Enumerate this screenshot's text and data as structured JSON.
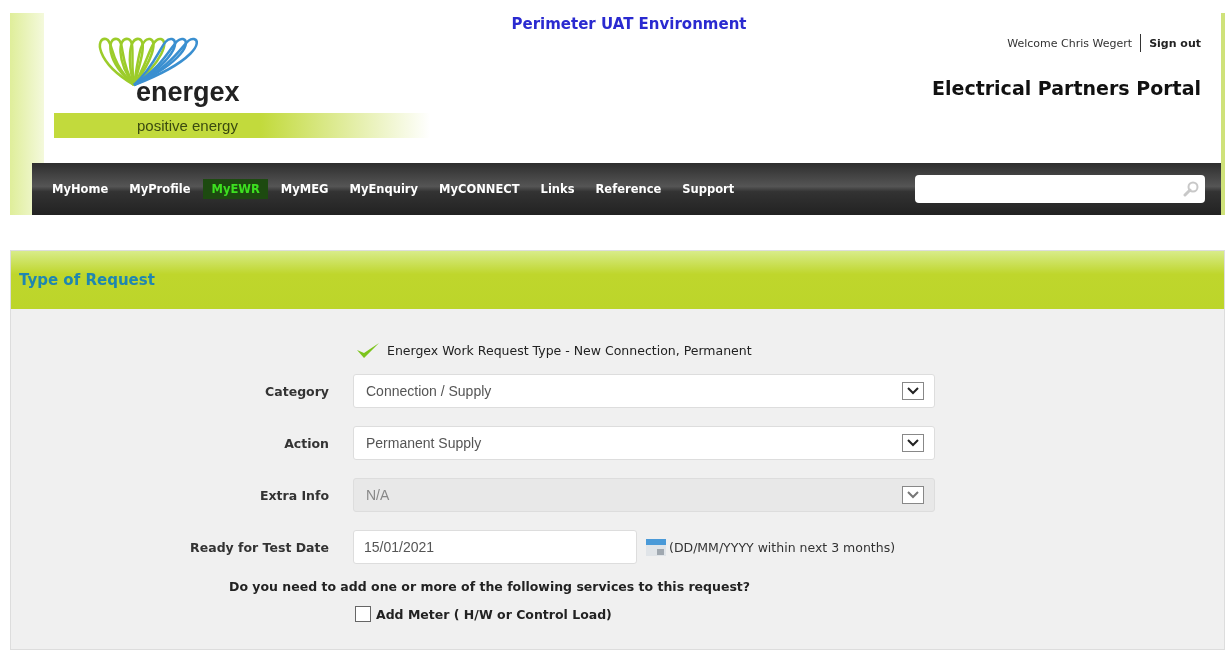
{
  "header": {
    "environment": "Perimeter UAT Environment",
    "logo": {
      "wordmark": "energex",
      "tagline": "positive energy"
    },
    "welcome": "Welcome Chris Wegert",
    "sign_out": "Sign out",
    "portal_title": "Electrical Partners Portal"
  },
  "nav": {
    "items": [
      {
        "label": "MyHome",
        "selected": false
      },
      {
        "label": "MyProfile",
        "selected": false
      },
      {
        "label": "MyEWR",
        "selected": true
      },
      {
        "label": "MyMEG",
        "selected": false
      },
      {
        "label": "MyEnquiry",
        "selected": false
      },
      {
        "label": "MyCONNECT",
        "selected": false
      },
      {
        "label": "Links",
        "selected": false
      },
      {
        "label": "Reference",
        "selected": false
      },
      {
        "label": "Support",
        "selected": false
      }
    ]
  },
  "section": {
    "title": "Type of Request",
    "request_type": "Energex Work Request Type - New Connection, Permanent",
    "fields": [
      {
        "kind": "select",
        "label": "Category",
        "value": "Connection / Supply",
        "disabled": false
      },
      {
        "kind": "select",
        "label": "Action",
        "value": "Permanent Supply",
        "disabled": false
      },
      {
        "kind": "select",
        "label": "Extra Info",
        "value": "N/A",
        "disabled": true
      },
      {
        "kind": "date",
        "label": "Ready for Test Date",
        "value": "15/01/2021",
        "hint": "(DD/MM/YYYY within next 3 months)"
      }
    ],
    "question": "Do you need to add one or more of the following services to this request?",
    "options": [
      {
        "label": "Add Meter ( H/W or Control Load)",
        "checked": false
      }
    ]
  }
}
